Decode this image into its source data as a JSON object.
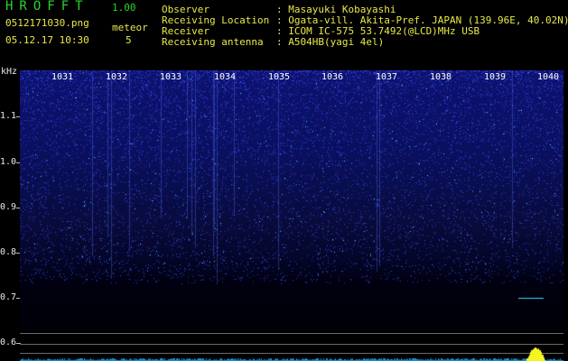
{
  "header": {
    "app_title": "HROFFT",
    "app_version": "1.00",
    "filename": "0512171030.png",
    "datetime": "05.12.17 10:30",
    "meteor_label": "meteor",
    "meteor_count": "5"
  },
  "info": [
    {
      "key": "Observer",
      "value": ": Masayuki Kobayashi"
    },
    {
      "key": "Receiving Location",
      "value": ": Ogata-vill. Akita-Pref. JAPAN (139.96E, 40.02N)"
    },
    {
      "key": "Receiver",
      "value": ": ICOM IC-575 53.7492(@LCD)MHz USB"
    },
    {
      "key": "Receiving antenna",
      "value": ": A504HB(yagi 4el)"
    }
  ],
  "y_axis": {
    "unit": "kHz",
    "ticks": [
      "1.1",
      "1.0",
      "0.9",
      "0.8",
      "0.7",
      "0.6"
    ]
  },
  "minute_labels": [
    "1031",
    "1032",
    "1033",
    "1034",
    "1035",
    "1036",
    "1037",
    "1038",
    "1039",
    "1040"
  ],
  "colors": {
    "title_green": "#29d629",
    "label_yellow": "#e8e84a",
    "noise_blue": "#3a4cff",
    "signal_cyan": "#35e0ff",
    "peak_yellow": "#f5f520"
  }
}
